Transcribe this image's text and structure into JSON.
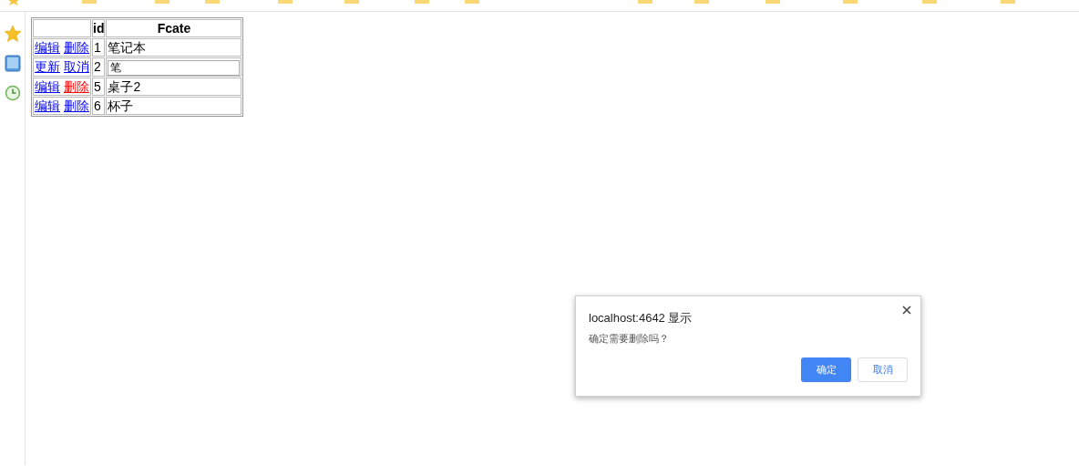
{
  "table": {
    "columns": [
      "id",
      "Fcate"
    ],
    "rows": [
      {
        "kind": "view",
        "actions": [
          {
            "label": "编辑",
            "active": false
          },
          {
            "label": "删除",
            "active": false
          }
        ],
        "id": "1",
        "fcate": "笔记本"
      },
      {
        "kind": "edit",
        "actions": [
          {
            "label": "更新",
            "active": false
          },
          {
            "label": "取消",
            "active": false
          }
        ],
        "id": "2",
        "fcate": "笔"
      },
      {
        "kind": "view",
        "actions": [
          {
            "label": "编辑",
            "active": false
          },
          {
            "label": "删除",
            "active": true
          }
        ],
        "id": "5",
        "fcate": "桌子2"
      },
      {
        "kind": "view",
        "actions": [
          {
            "label": "编辑",
            "active": false
          },
          {
            "label": "删除",
            "active": false
          }
        ],
        "id": "6",
        "fcate": "杯子"
      }
    ]
  },
  "dialog": {
    "title": "localhost:4642 显示",
    "message": "确定需要删除吗？",
    "buttons": [
      {
        "label": "确定",
        "primary": true
      },
      {
        "label": "取消",
        "primary": false
      }
    ]
  }
}
